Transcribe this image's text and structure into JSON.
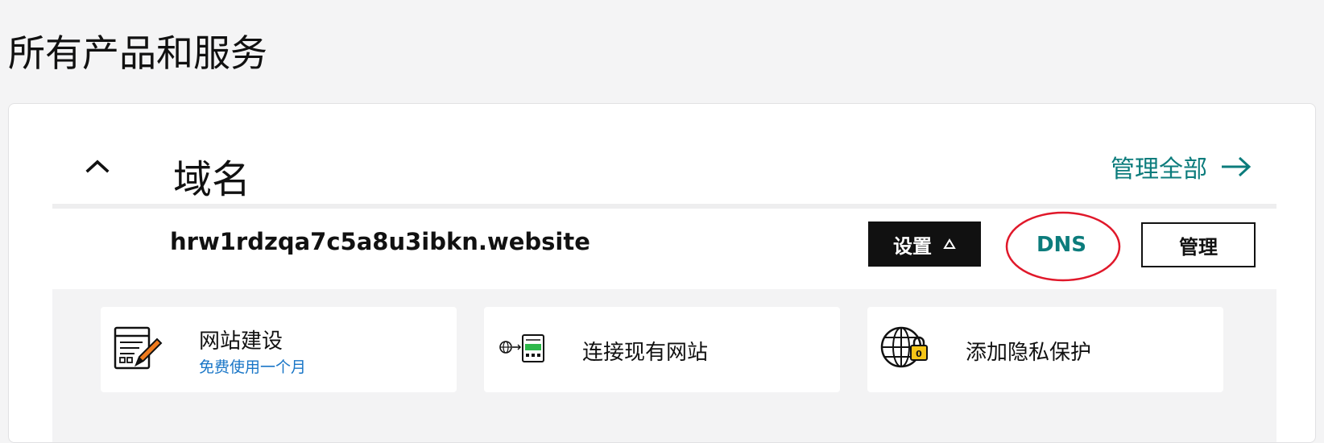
{
  "page": {
    "title": "所有产品和服务"
  },
  "section": {
    "title": "域名",
    "manage_all_label": "管理全部",
    "collapse_icon": "chevron-up-icon",
    "arrow_icon": "arrow-right-icon"
  },
  "domain": {
    "name": "hrw1rdzqa7c5a8u3ibkn.website",
    "settings_label": "设置",
    "settings_icon": "triangle-up-icon",
    "dns_label": "DNS",
    "manage_label": "管理"
  },
  "tiles": [
    {
      "label": "网站建设",
      "subtitle": "免费使用一个月",
      "icon": "website-builder-icon"
    },
    {
      "label": "连接现有网站",
      "icon": "connect-website-icon"
    },
    {
      "label": "添加隐私保护",
      "icon": "privacy-lock-globe-icon"
    }
  ],
  "colors": {
    "accent": "#0c7c7c",
    "link_blue": "#1976c7",
    "annotation_red": "#e0182a",
    "background": "#f4f4f5"
  }
}
